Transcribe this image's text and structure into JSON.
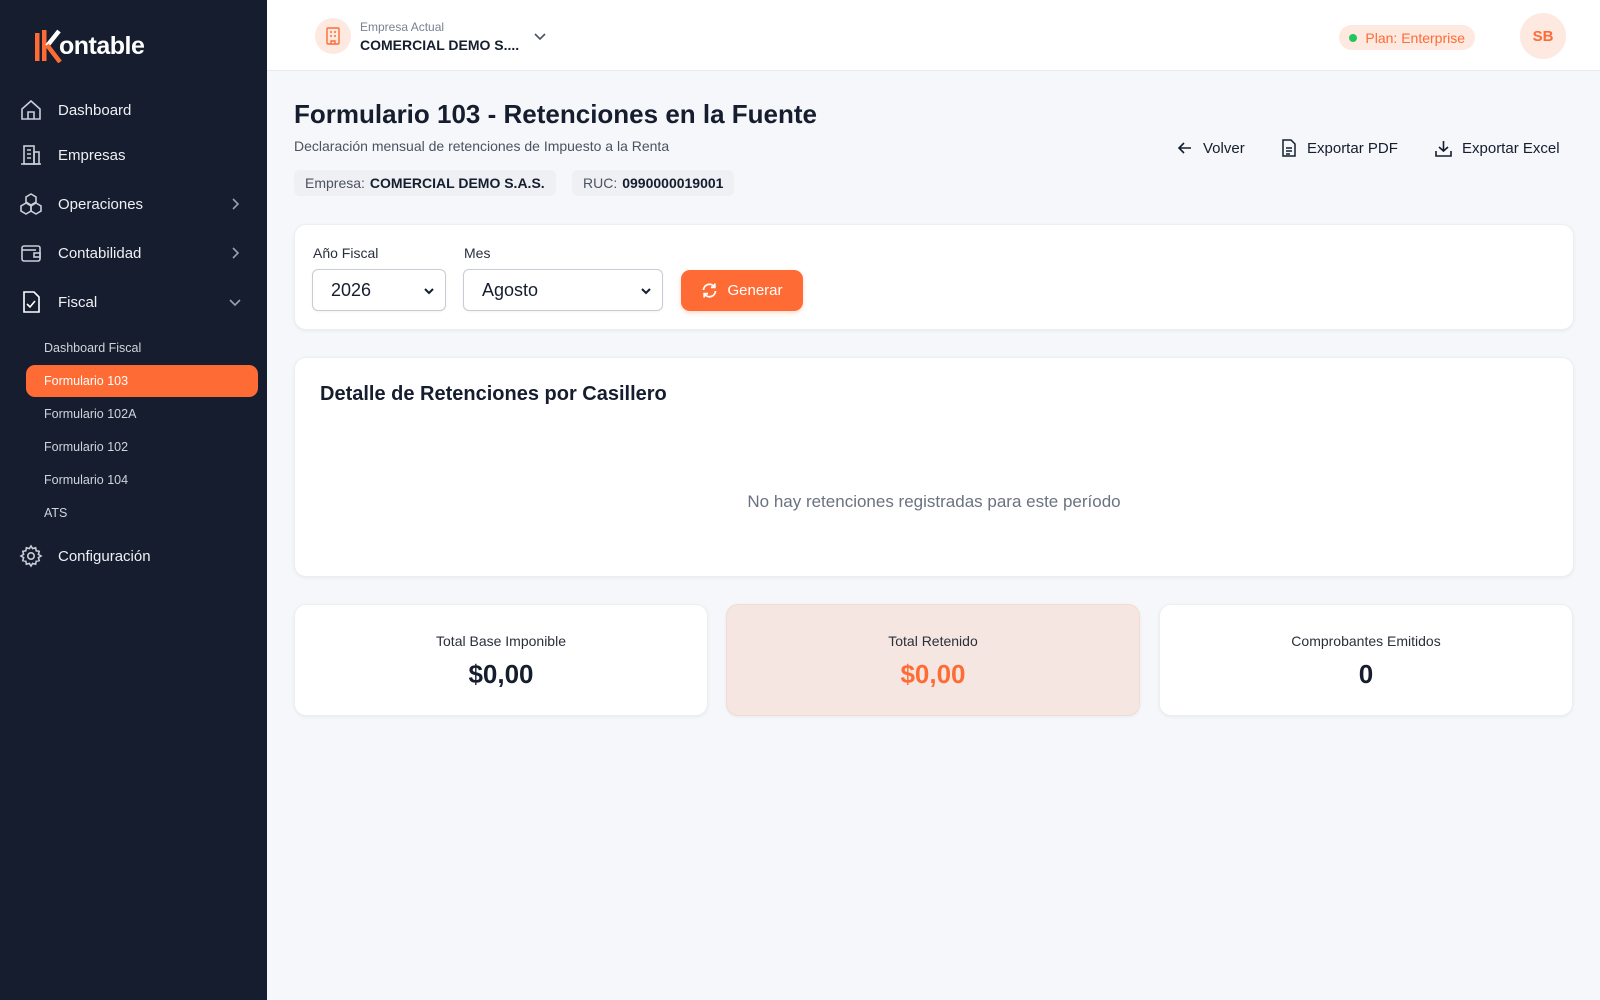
{
  "app": {
    "logo_text": "ontable"
  },
  "colors": {
    "accent": "#ff6b35",
    "sidebar_bg": "#151d2e",
    "plan_dot": "#22c55e"
  },
  "sidebar": {
    "items": [
      {
        "label": "Dashboard",
        "icon": "home-icon"
      },
      {
        "label": "Empresas",
        "icon": "building-icon"
      },
      {
        "label": "Operaciones",
        "icon": "cubes-icon"
      },
      {
        "label": "Contabilidad",
        "icon": "wallet-icon"
      },
      {
        "label": "Fiscal",
        "icon": "document-check-icon"
      },
      {
        "label": "Configuración",
        "icon": "gear-icon"
      }
    ],
    "fiscal_sub": [
      {
        "label": "Dashboard Fiscal"
      },
      {
        "label": "Formulario 103"
      },
      {
        "label": "Formulario 102A"
      },
      {
        "label": "Formulario 102"
      },
      {
        "label": "Formulario 104"
      },
      {
        "label": "ATS"
      }
    ]
  },
  "header": {
    "company_caption": "Empresa Actual",
    "company_name": "COMERCIAL DEMO S....",
    "plan_label": "Plan: Enterprise",
    "avatar_initials": "SB"
  },
  "page": {
    "title": "Formulario 103 - Retenciones en la Fuente",
    "subtitle": "Declaración mensual de retenciones de Impuesto a la Renta",
    "empresa_label": "Empresa:",
    "empresa_value": "COMERCIAL DEMO S.A.S.",
    "ruc_label": "RUC:",
    "ruc_value": "0990000019001",
    "actions": {
      "back": "Volver",
      "export_pdf": "Exportar PDF",
      "export_excel": "Exportar Excel"
    }
  },
  "filters": {
    "year_label": "Año Fiscal",
    "year_value": "2026",
    "month_label": "Mes",
    "month_value": "Agosto",
    "generate_label": "Generar"
  },
  "detail": {
    "title": "Detalle de Retenciones por Casillero",
    "empty_message": "No hay retenciones registradas para este período"
  },
  "stats": [
    {
      "label": "Total Base Imponible",
      "value": "$0,00"
    },
    {
      "label": "Total Retenido",
      "value": "$0,00"
    },
    {
      "label": "Comprobantes Emitidos",
      "value": "0"
    }
  ]
}
